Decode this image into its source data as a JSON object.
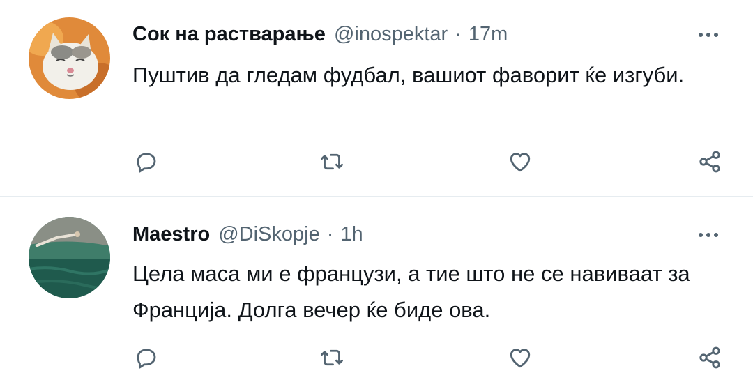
{
  "tweets": [
    {
      "display_name": "Сок на растварање",
      "handle": "@inospektar",
      "separator": "·",
      "time": "17m",
      "text": "Пуштив да гледам фудбал, вашиот фаворит ќе изгуби."
    },
    {
      "display_name": "Maestro",
      "handle": "@DiSkopje",
      "separator": "·",
      "time": "1h",
      "text": "Цела маса ми е французи, а тие што не се навиваат за Франција. Долга вечер ќе биде ова."
    }
  ],
  "icons": {
    "reply": "reply-icon",
    "retweet": "retweet-icon",
    "like": "like-icon",
    "share": "share-icon",
    "more": "more-icon"
  },
  "colors": {
    "primary_text": "#0f1419",
    "secondary_text": "#536471",
    "divider": "#e6ecf0"
  }
}
